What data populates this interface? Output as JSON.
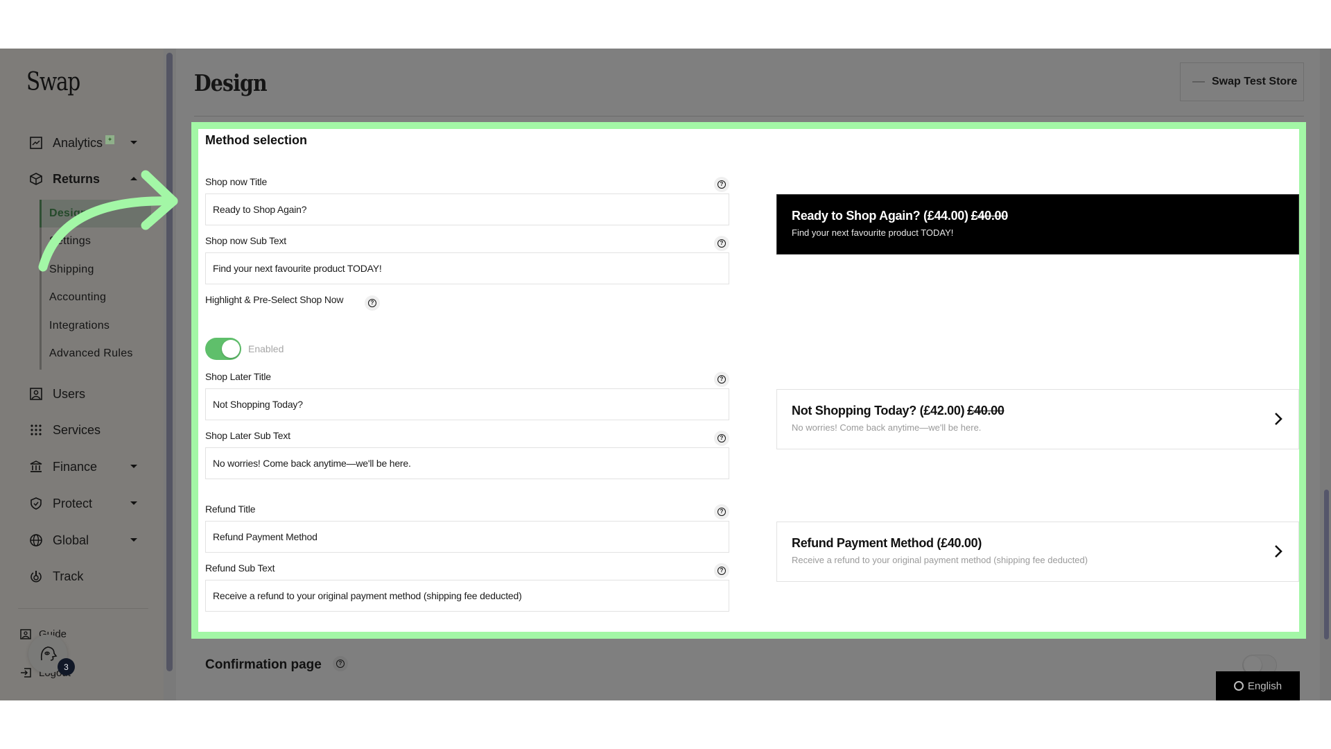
{
  "app": {
    "logo": "Swap",
    "page_title": "Design",
    "store_name": "Swap Test Store"
  },
  "sidebar": {
    "items": [
      {
        "label": "Analytics",
        "icon": "chart-line-icon",
        "has_caret": true,
        "badge": "sparkle"
      },
      {
        "label": "Returns",
        "icon": "package-icon",
        "has_caret": true,
        "expanded": true
      },
      {
        "label": "Users",
        "icon": "user-card-icon"
      },
      {
        "label": "Services",
        "icon": "grid-dots-icon"
      },
      {
        "label": "Finance",
        "icon": "bank-icon",
        "has_caret": true
      },
      {
        "label": "Protect",
        "icon": "shield-check-icon",
        "has_caret": true
      },
      {
        "label": "Global",
        "icon": "globe-icon",
        "has_caret": true
      },
      {
        "label": "Track",
        "icon": "track-pin-icon"
      }
    ],
    "returns_sub_items": [
      {
        "label": "Design",
        "active": true
      },
      {
        "label": "Settings"
      },
      {
        "label": "Shipping"
      },
      {
        "label": "Accounting"
      },
      {
        "label": "Integrations"
      },
      {
        "label": "Advanced Rules"
      }
    ],
    "footer": [
      {
        "label": "Guide",
        "icon": "guide-icon"
      },
      {
        "label": "Logout",
        "icon": "logout-icon"
      }
    ],
    "chat_badge_count": "3"
  },
  "method_selection": {
    "title": "Method selection",
    "fields": [
      {
        "label": "Shop now Title",
        "value": "Ready to Shop Again?"
      },
      {
        "label": "Shop now Sub Text",
        "value": "Find your next favourite product TODAY!"
      },
      {
        "label": "Shop Later Title",
        "value": "Not Shopping Today?"
      },
      {
        "label": "Shop Later Sub Text",
        "value": "No worries! Come back anytime—we'll be here."
      },
      {
        "label": "Refund Title",
        "value": "Refund Payment Method"
      },
      {
        "label": "Refund Sub Text",
        "value": "Receive a refund to your original payment method (shipping fee deducted)"
      }
    ],
    "highlight_toggle": {
      "label": "Highlight & Pre-Select Shop Now",
      "state_label": "Enabled",
      "enabled": true
    },
    "previews": [
      {
        "title": "Ready to Shop Again? (£44.00)",
        "original_price": "£40.00",
        "subtitle": "Find your next favourite product TODAY!",
        "highlighted": true
      },
      {
        "title": "Not Shopping Today? (£42.00)",
        "original_price": "£40.00",
        "subtitle": "No worries! Come back anytime—we'll be here."
      },
      {
        "title": "Refund Payment Method (£40.00)",
        "original_price": "",
        "subtitle": "Receive a refund to your original payment method (shipping fee deducted)"
      }
    ]
  },
  "confirmation_page": {
    "title": "Confirmation page",
    "enabled": false
  },
  "language": {
    "label": "English"
  },
  "colors": {
    "highlight_border": "#a3f7a6",
    "toggle_on": "#5fbf6b",
    "overlay": "#7f7f7f"
  }
}
